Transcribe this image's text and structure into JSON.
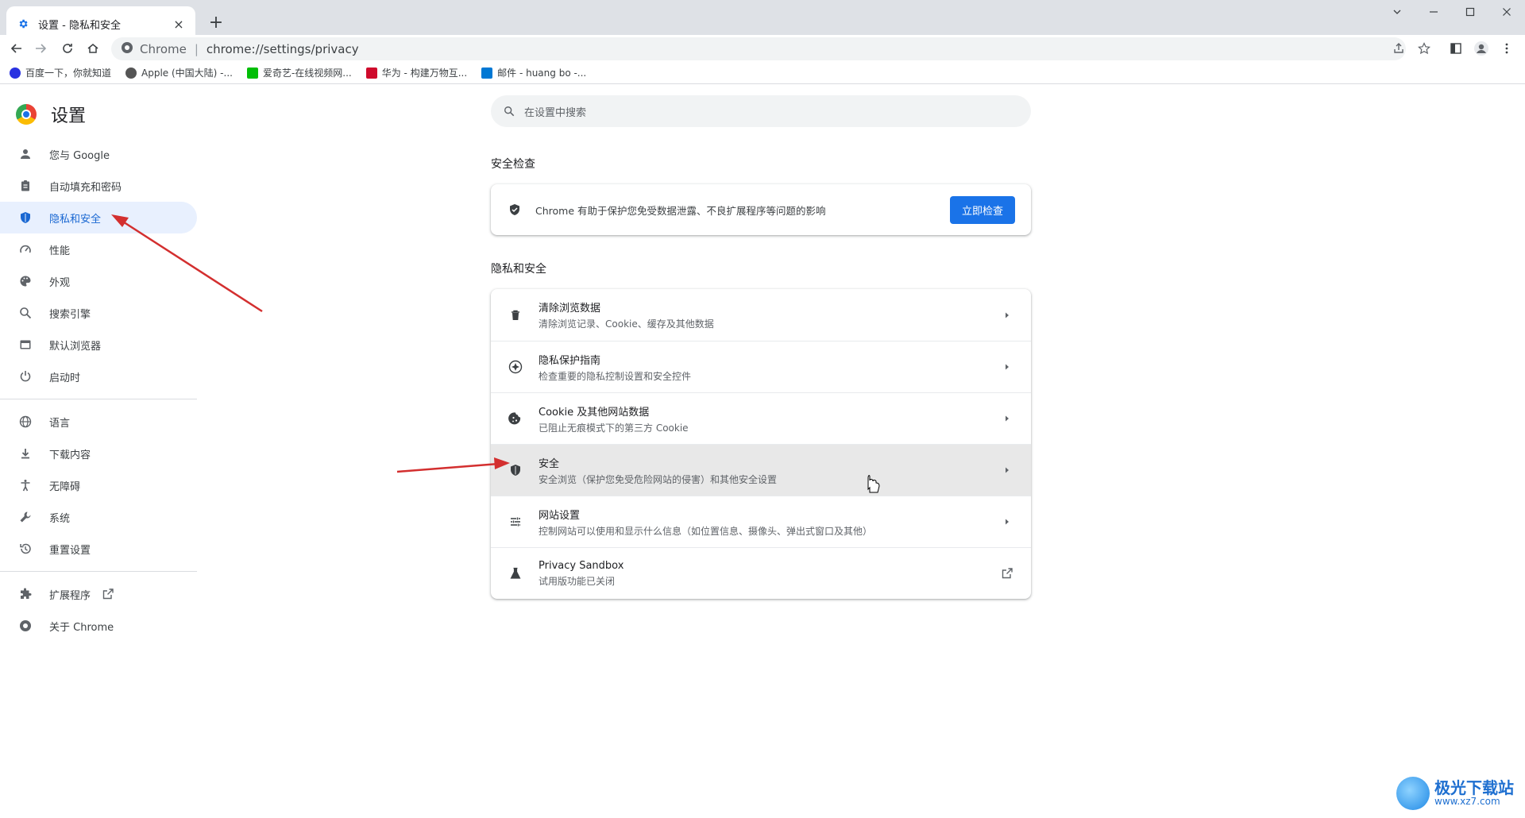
{
  "window": {
    "tab_title": "设置 - 隐私和安全",
    "new_tab_symbol": "+",
    "close_tab_symbol": "×"
  },
  "toolbar": {
    "site_chip": "Chrome",
    "separator": "|",
    "url": "chrome://settings/privacy"
  },
  "bookmarks": [
    {
      "label": "百度一下，你就知道",
      "icon_color": "#2932e1"
    },
    {
      "label": "Apple (中国大陆) -...",
      "icon_color": "#555555"
    },
    {
      "label": "爱奇艺-在线视频网...",
      "icon_color": "#00be06"
    },
    {
      "label": "华为 - 构建万物互...",
      "icon_color": "#cf0a2c"
    },
    {
      "label": "邮件 - huang bo -...",
      "icon_color": "#0078d4"
    }
  ],
  "sidebar": {
    "title": "设置",
    "items": [
      {
        "label": "您与 Google",
        "icon": "person-icon"
      },
      {
        "label": "自动填充和密码",
        "icon": "clipboard-icon"
      },
      {
        "label": "隐私和安全",
        "icon": "shield-icon",
        "active": true
      },
      {
        "label": "性能",
        "icon": "speedometer-icon"
      },
      {
        "label": "外观",
        "icon": "palette-icon"
      },
      {
        "label": "搜索引擎",
        "icon": "search-icon"
      },
      {
        "label": "默认浏览器",
        "icon": "browser-icon"
      },
      {
        "label": "启动时",
        "icon": "power-icon"
      }
    ],
    "items2": [
      {
        "label": "语言",
        "icon": "globe-icon"
      },
      {
        "label": "下载内容",
        "icon": "download-icon"
      },
      {
        "label": "无障碍",
        "icon": "accessibility-icon"
      },
      {
        "label": "系统",
        "icon": "wrench-icon"
      },
      {
        "label": "重置设置",
        "icon": "history-icon"
      }
    ],
    "items3": [
      {
        "label": "扩展程序",
        "icon": "puzzle-icon"
      },
      {
        "label": "关于 Chrome",
        "icon": "chrome-icon"
      }
    ]
  },
  "search": {
    "placeholder": "在设置中搜索"
  },
  "safety_check": {
    "title": "安全检查",
    "text": "Chrome 有助于保护您免受数据泄露、不良扩展程序等问题的影响",
    "button": "立即检查"
  },
  "privacy": {
    "title": "隐私和安全",
    "rows": [
      {
        "title": "清除浏览数据",
        "subtitle": "清除浏览记录、Cookie、缓存及其他数据",
        "icon": "trash-icon",
        "action": "arrow"
      },
      {
        "title": "隐私保护指南",
        "subtitle": "检查重要的隐私控制设置和安全控件",
        "icon": "compass-icon",
        "action": "arrow"
      },
      {
        "title": "Cookie 及其他网站数据",
        "subtitle": "已阻止无痕模式下的第三方 Cookie",
        "icon": "cookie-icon",
        "action": "arrow"
      },
      {
        "title": "安全",
        "subtitle": "安全浏览（保护您免受危险网站的侵害）和其他安全设置",
        "icon": "shield-icon",
        "action": "arrow",
        "hover": true
      },
      {
        "title": "网站设置",
        "subtitle": "控制网站可以使用和显示什么信息（如位置信息、摄像头、弹出式窗口及其他）",
        "icon": "tune-icon",
        "action": "arrow"
      },
      {
        "title": "Privacy Sandbox",
        "subtitle": "试用版功能已关闭",
        "icon": "flask-icon",
        "action": "external"
      }
    ]
  },
  "watermark": {
    "line1": "极光下载站",
    "line2": "www.xz7.com"
  },
  "colors": {
    "accent": "#1a73e8",
    "active_bg": "#e8f0fe",
    "arrow_red": "#d32f2f"
  }
}
